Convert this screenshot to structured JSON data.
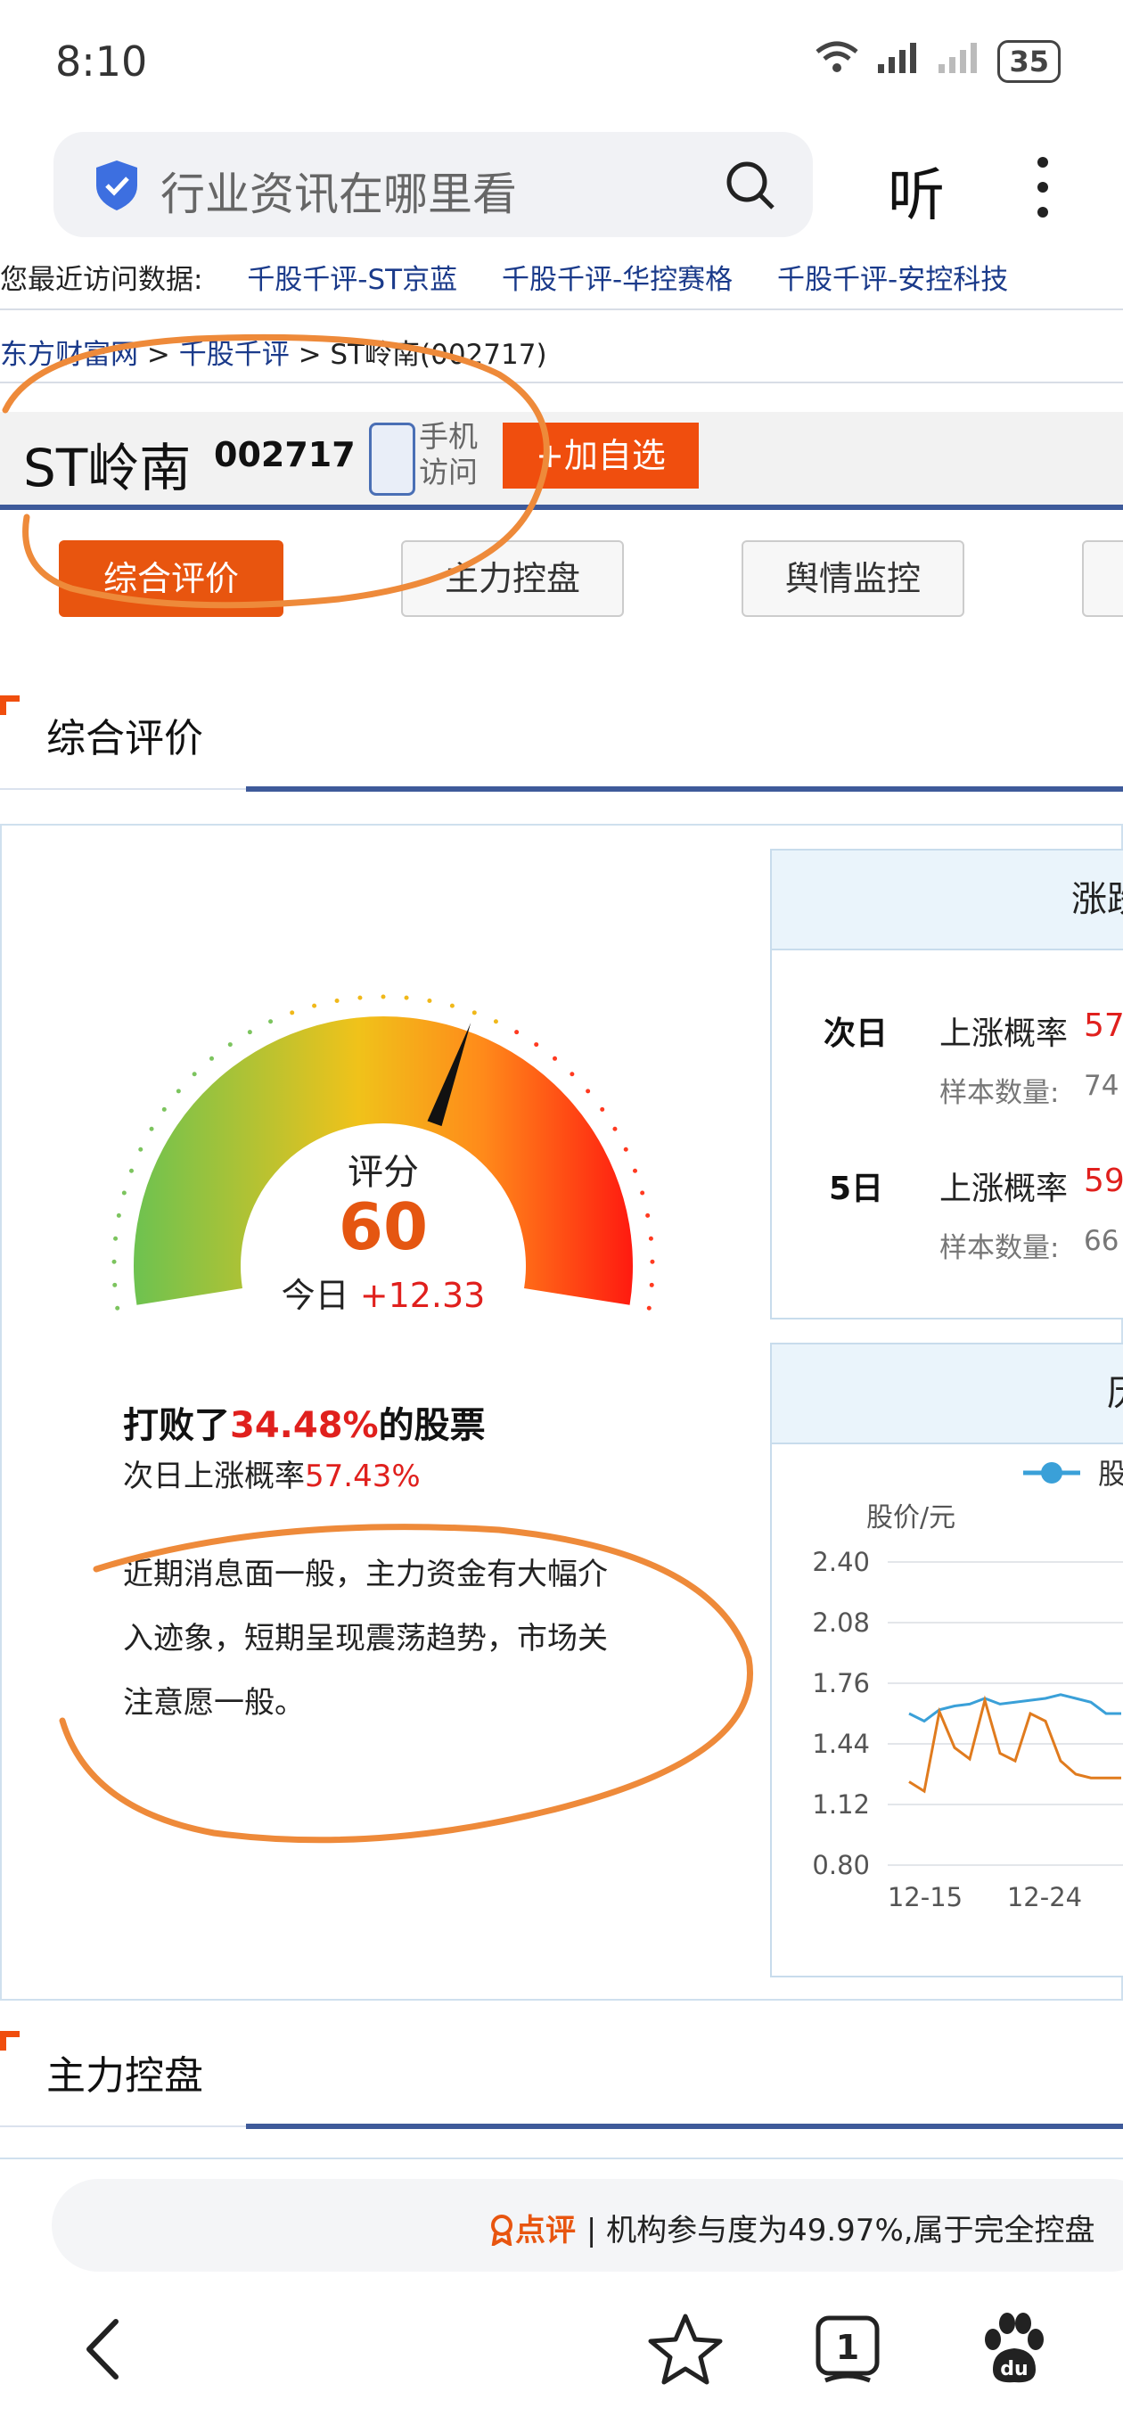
{
  "status_bar": {
    "time": "8:10",
    "battery": "35"
  },
  "browser": {
    "search_placeholder": "行业资讯在哪里看",
    "listen_label": "听"
  },
  "recent": {
    "label": "您最近访问数据:",
    "links": [
      "千股千评-ST京蓝",
      "千股千评-华控赛格",
      "千股千评-安控科技"
    ]
  },
  "breadcrumb": {
    "site": "东方财富网",
    "section": "千股千评",
    "current": "ST岭南(002717)"
  },
  "stock": {
    "name": "ST岭南",
    "code": "002717",
    "mobile_visit_line1": "手机",
    "mobile_visit_line2": "访问",
    "add_label": "+加自选"
  },
  "tabs": [
    "综合评价",
    "主力控盘",
    "舆情监控"
  ],
  "section1": {
    "title": "综合评价"
  },
  "gauge": {
    "label": "评分",
    "score": 60,
    "score_fraction": 0.6,
    "today_label": "今日",
    "today_change": "+12.33"
  },
  "evaluation": {
    "beat_prefix": "打败了",
    "beat_pct": "34.48%",
    "beat_suffix": "的股票",
    "next_prefix": "次日上涨概率",
    "next_pct": "57.43%",
    "summary": "近期消息面一般，主力资金有大幅介入迹象，短期呈现震荡趋势，市场关注意愿一般。"
  },
  "prob_panel": {
    "title": "涨跌",
    "rows": [
      {
        "day": "次日",
        "label": "上涨概率",
        "value": "57",
        "sample_label": "样本数量:",
        "sample_value": "74"
      },
      {
        "day": "5日",
        "label": "上涨概率",
        "value": "59",
        "sample_label": "样本数量:",
        "sample_value": "66"
      }
    ]
  },
  "history_panel": {
    "title": "历",
    "legend": "股",
    "y_axis_label": "股价/元"
  },
  "chart_data": {
    "type": "line",
    "ylabel": "股价/元",
    "ylim": [
      0.8,
      2.4
    ],
    "y_ticks": [
      "2.40",
      "2.08",
      "1.76",
      "1.44",
      "1.12",
      "0.80"
    ],
    "x_ticks": [
      "12-15",
      "12-24"
    ],
    "series": [
      {
        "name": "股",
        "color": "#3aa0d8",
        "values": [
          1.6,
          1.56,
          1.62,
          1.64,
          1.65,
          1.68,
          1.65,
          1.66,
          1.67,
          1.68,
          1.7,
          1.68,
          1.66,
          1.6,
          1.6
        ]
      },
      {
        "color": "#e07b1e",
        "values": [
          1.24,
          1.19,
          1.61,
          1.42,
          1.36,
          1.67,
          1.39,
          1.35,
          1.6,
          1.56,
          1.35,
          1.28,
          1.26,
          1.26,
          1.26
        ]
      }
    ]
  },
  "section2": {
    "title": "主力控盘"
  },
  "dianping": {
    "tag": "点评",
    "text": "| 机构参与度为49.97%,属于完全控盘"
  },
  "nav": {
    "tab_count": "1"
  },
  "colors": {
    "accent": "#e8550f",
    "rise": "#e0201d",
    "rule": "#3e5a9a",
    "annotation": "#ee8a3a"
  }
}
